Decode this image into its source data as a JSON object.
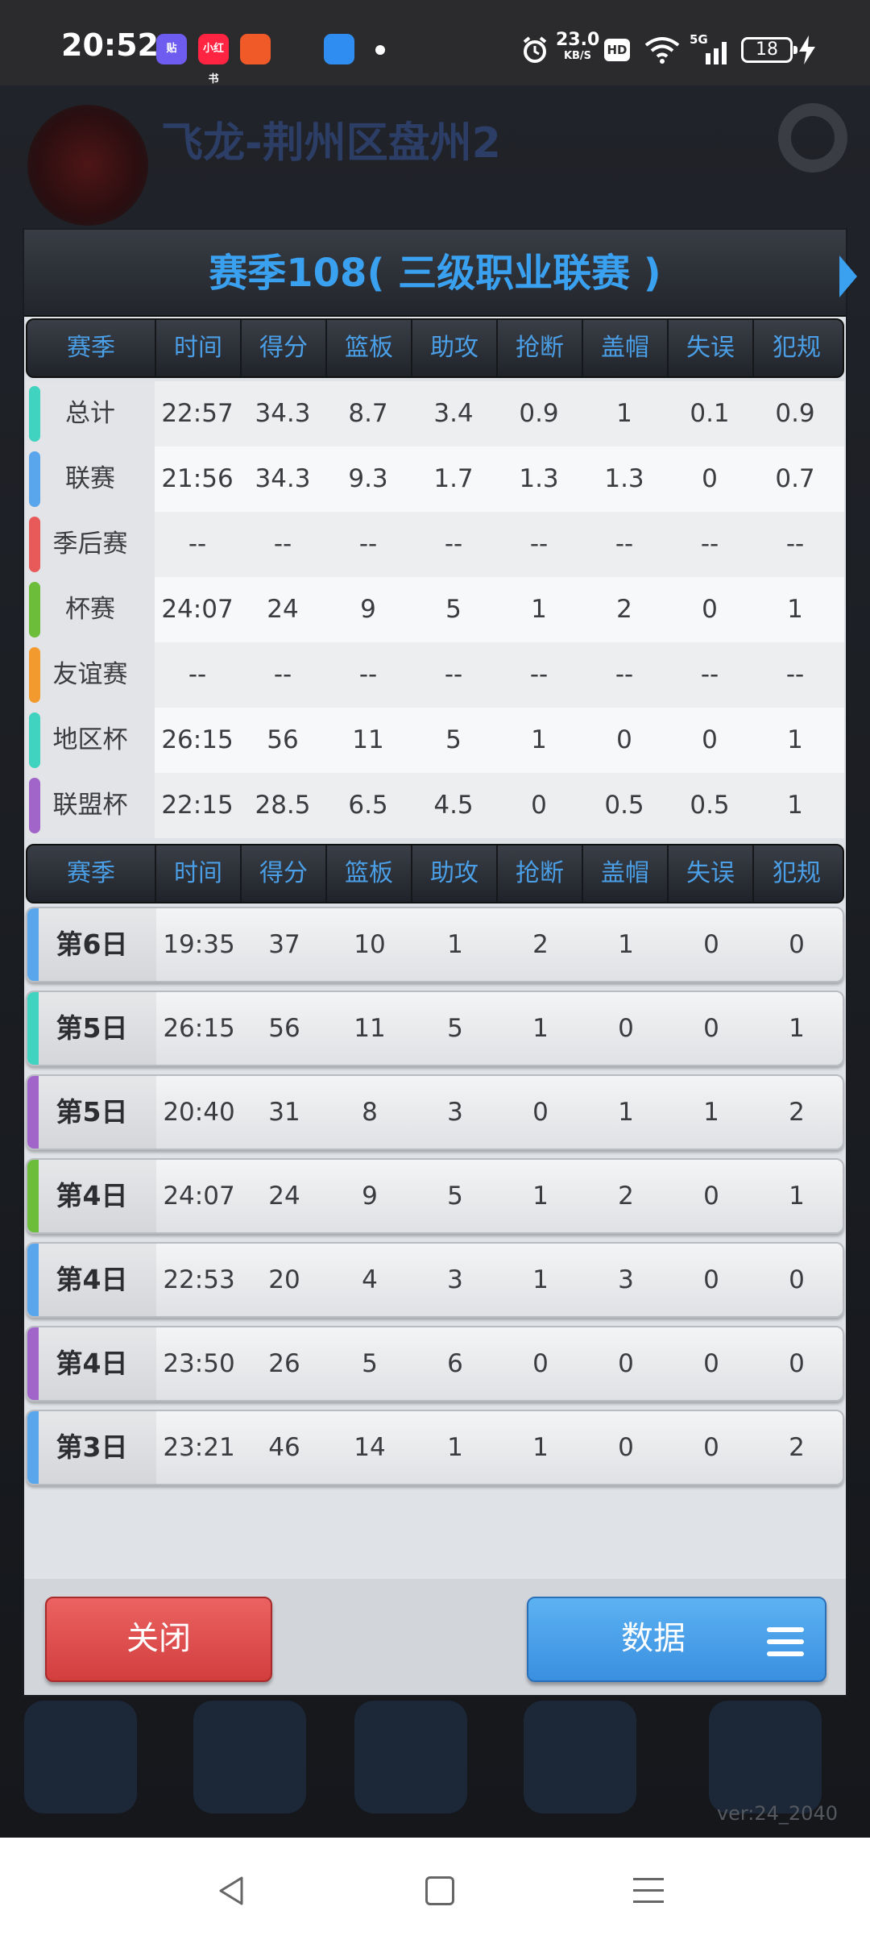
{
  "status_bar": {
    "time": "20:52",
    "apps": [
      {
        "icon": "tieba-app-icon",
        "label": "贴",
        "color": "#6e5bf0"
      },
      {
        "icon": "xiaohongshu-app-icon",
        "label": "小红书",
        "color": "#ff2442"
      },
      {
        "icon": "shop-app-icon",
        "label": "",
        "color": "#f05a28"
      },
      {
        "icon": "bilibili-app-icon",
        "label": "",
        "color": "#2b2b2d"
      },
      {
        "icon": "browser-app-icon",
        "label": "",
        "color": "#2f8cf0"
      }
    ],
    "net_speed": "23.0",
    "net_unit": "KB/S",
    "hd": "HD",
    "signal": "5G",
    "battery": "18"
  },
  "background": {
    "team_title": "飞龙-荆州区盘州2",
    "version": "ver:24_2040"
  },
  "modal": {
    "title": "赛季108( 三级职业联赛 )",
    "columns": [
      "赛季",
      "时间",
      "得分",
      "篮板",
      "助攻",
      "抢断",
      "盖帽",
      "失误",
      "犯规"
    ],
    "summary": [
      {
        "label": "总计",
        "color": "#3fd3c0",
        "stats": [
          "22:57",
          "34.3",
          "8.7",
          "3.4",
          "0.9",
          "1",
          "0.1",
          "0.9"
        ]
      },
      {
        "label": "联赛",
        "color": "#5aa6ec",
        "stats": [
          "21:56",
          "34.3",
          "9.3",
          "1.7",
          "1.3",
          "1.3",
          "0",
          "0.7"
        ]
      },
      {
        "label": "季后赛",
        "color": "#e85a5a",
        "stats": [
          "--",
          "--",
          "--",
          "--",
          "--",
          "--",
          "--",
          "--"
        ]
      },
      {
        "label": "杯赛",
        "color": "#6cbd3a",
        "stats": [
          "24:07",
          "24",
          "9",
          "5",
          "1",
          "2",
          "0",
          "1"
        ]
      },
      {
        "label": "友谊赛",
        "color": "#f39a2f",
        "stats": [
          "--",
          "--",
          "--",
          "--",
          "--",
          "--",
          "--",
          "--"
        ]
      },
      {
        "label": "地区杯",
        "color": "#3fd3c0",
        "stats": [
          "26:15",
          "56",
          "11",
          "5",
          "1",
          "0",
          "0",
          "1"
        ]
      },
      {
        "label": "联盟杯",
        "color": "#a164c8",
        "stats": [
          "22:15",
          "28.5",
          "6.5",
          "4.5",
          "0",
          "0.5",
          "0.5",
          "1"
        ]
      }
    ],
    "games": [
      {
        "label": "第6日",
        "color": "#5aa6ec",
        "stats": [
          "19:35",
          "37",
          "10",
          "1",
          "2",
          "1",
          "0",
          "0"
        ]
      },
      {
        "label": "第5日",
        "color": "#3fd3c0",
        "stats": [
          "26:15",
          "56",
          "11",
          "5",
          "1",
          "0",
          "0",
          "1"
        ]
      },
      {
        "label": "第5日",
        "color": "#a164c8",
        "stats": [
          "20:40",
          "31",
          "8",
          "3",
          "0",
          "1",
          "1",
          "2"
        ]
      },
      {
        "label": "第4日",
        "color": "#6cbd3a",
        "stats": [
          "24:07",
          "24",
          "9",
          "5",
          "1",
          "2",
          "0",
          "1"
        ]
      },
      {
        "label": "第4日",
        "color": "#5aa6ec",
        "stats": [
          "22:53",
          "20",
          "4",
          "3",
          "1",
          "3",
          "0",
          "0"
        ]
      },
      {
        "label": "第4日",
        "color": "#a164c8",
        "stats": [
          "23:50",
          "26",
          "5",
          "6",
          "0",
          "0",
          "0",
          "0"
        ]
      },
      {
        "label": "第3日",
        "color": "#5aa6ec",
        "stats": [
          "23:21",
          "46",
          "14",
          "1",
          "1",
          "0",
          "0",
          "2"
        ]
      }
    ],
    "close_label": "关闭",
    "data_label": "数据"
  },
  "nav": {
    "back_icon": "back-triangle-icon",
    "home_icon": "home-square-icon",
    "menu_icon": "recents-lines-icon"
  }
}
